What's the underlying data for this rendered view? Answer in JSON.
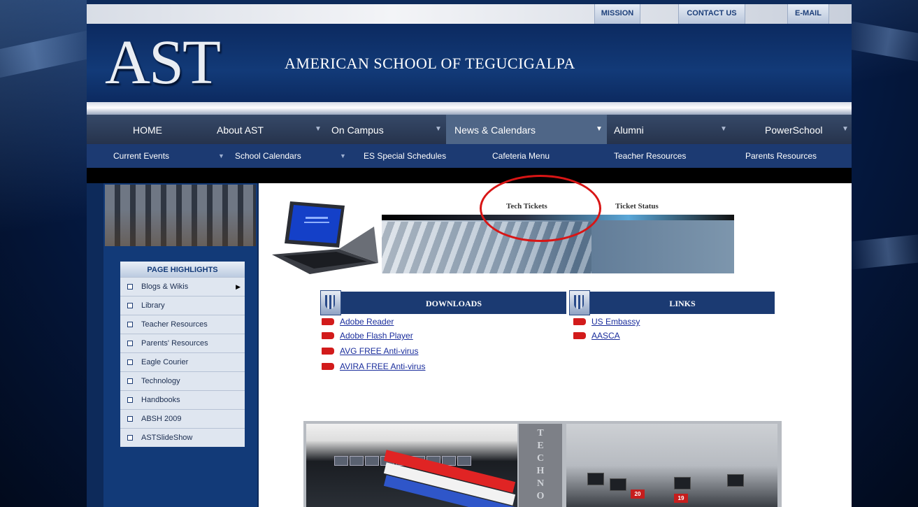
{
  "util_links": [
    "MISSION",
    "CONTACT US",
    "E-MAIL"
  ],
  "header": {
    "logo_text": "AST",
    "school_name": "AMERICAN SCHOOL OF TEGUCIGALPA"
  },
  "main_nav": [
    "HOME",
    "About AST",
    "On Campus",
    "News & Calendars",
    "Alumni",
    "PowerSchool"
  ],
  "main_nav_active": "News & Calendars",
  "sub_nav": [
    "Current Events",
    "School Calendars",
    "ES Special Schedules",
    "Cafeteria Menu",
    "Teacher Resources",
    "Parents Resources"
  ],
  "page_highlights": {
    "title": "PAGE HIGHLIGHTS",
    "items": [
      "Blogs & Wikis",
      "Library",
      "Teacher Resources",
      "Parents' Resources",
      "Eagle Courier",
      "Technology",
      "Handbooks",
      "ABSH 2009",
      "ASTSlideShow"
    ]
  },
  "tech_tabs": {
    "tech_tickets": "Tech Tickets",
    "ticket_status": "Ticket Status"
  },
  "downloads": {
    "title": "DOWNLOADS",
    "items": [
      "Adobe Reader",
      "Adobe Flash Player",
      "AVG FREE Anti-virus",
      "AVIRA FREE Anti-virus"
    ]
  },
  "links": {
    "title": "LINKS",
    "items": [
      "US Embassy",
      "AASCA"
    ]
  },
  "techno_letters": [
    "T",
    "E",
    "C",
    "H",
    "N",
    "O"
  ],
  "lab_signs": [
    "20",
    "19"
  ],
  "colors": {
    "brand_navy": "#123a78",
    "nav_active": "#4f6687",
    "annotation_red": "#d81515",
    "link_blue": "#1a2d9c"
  }
}
